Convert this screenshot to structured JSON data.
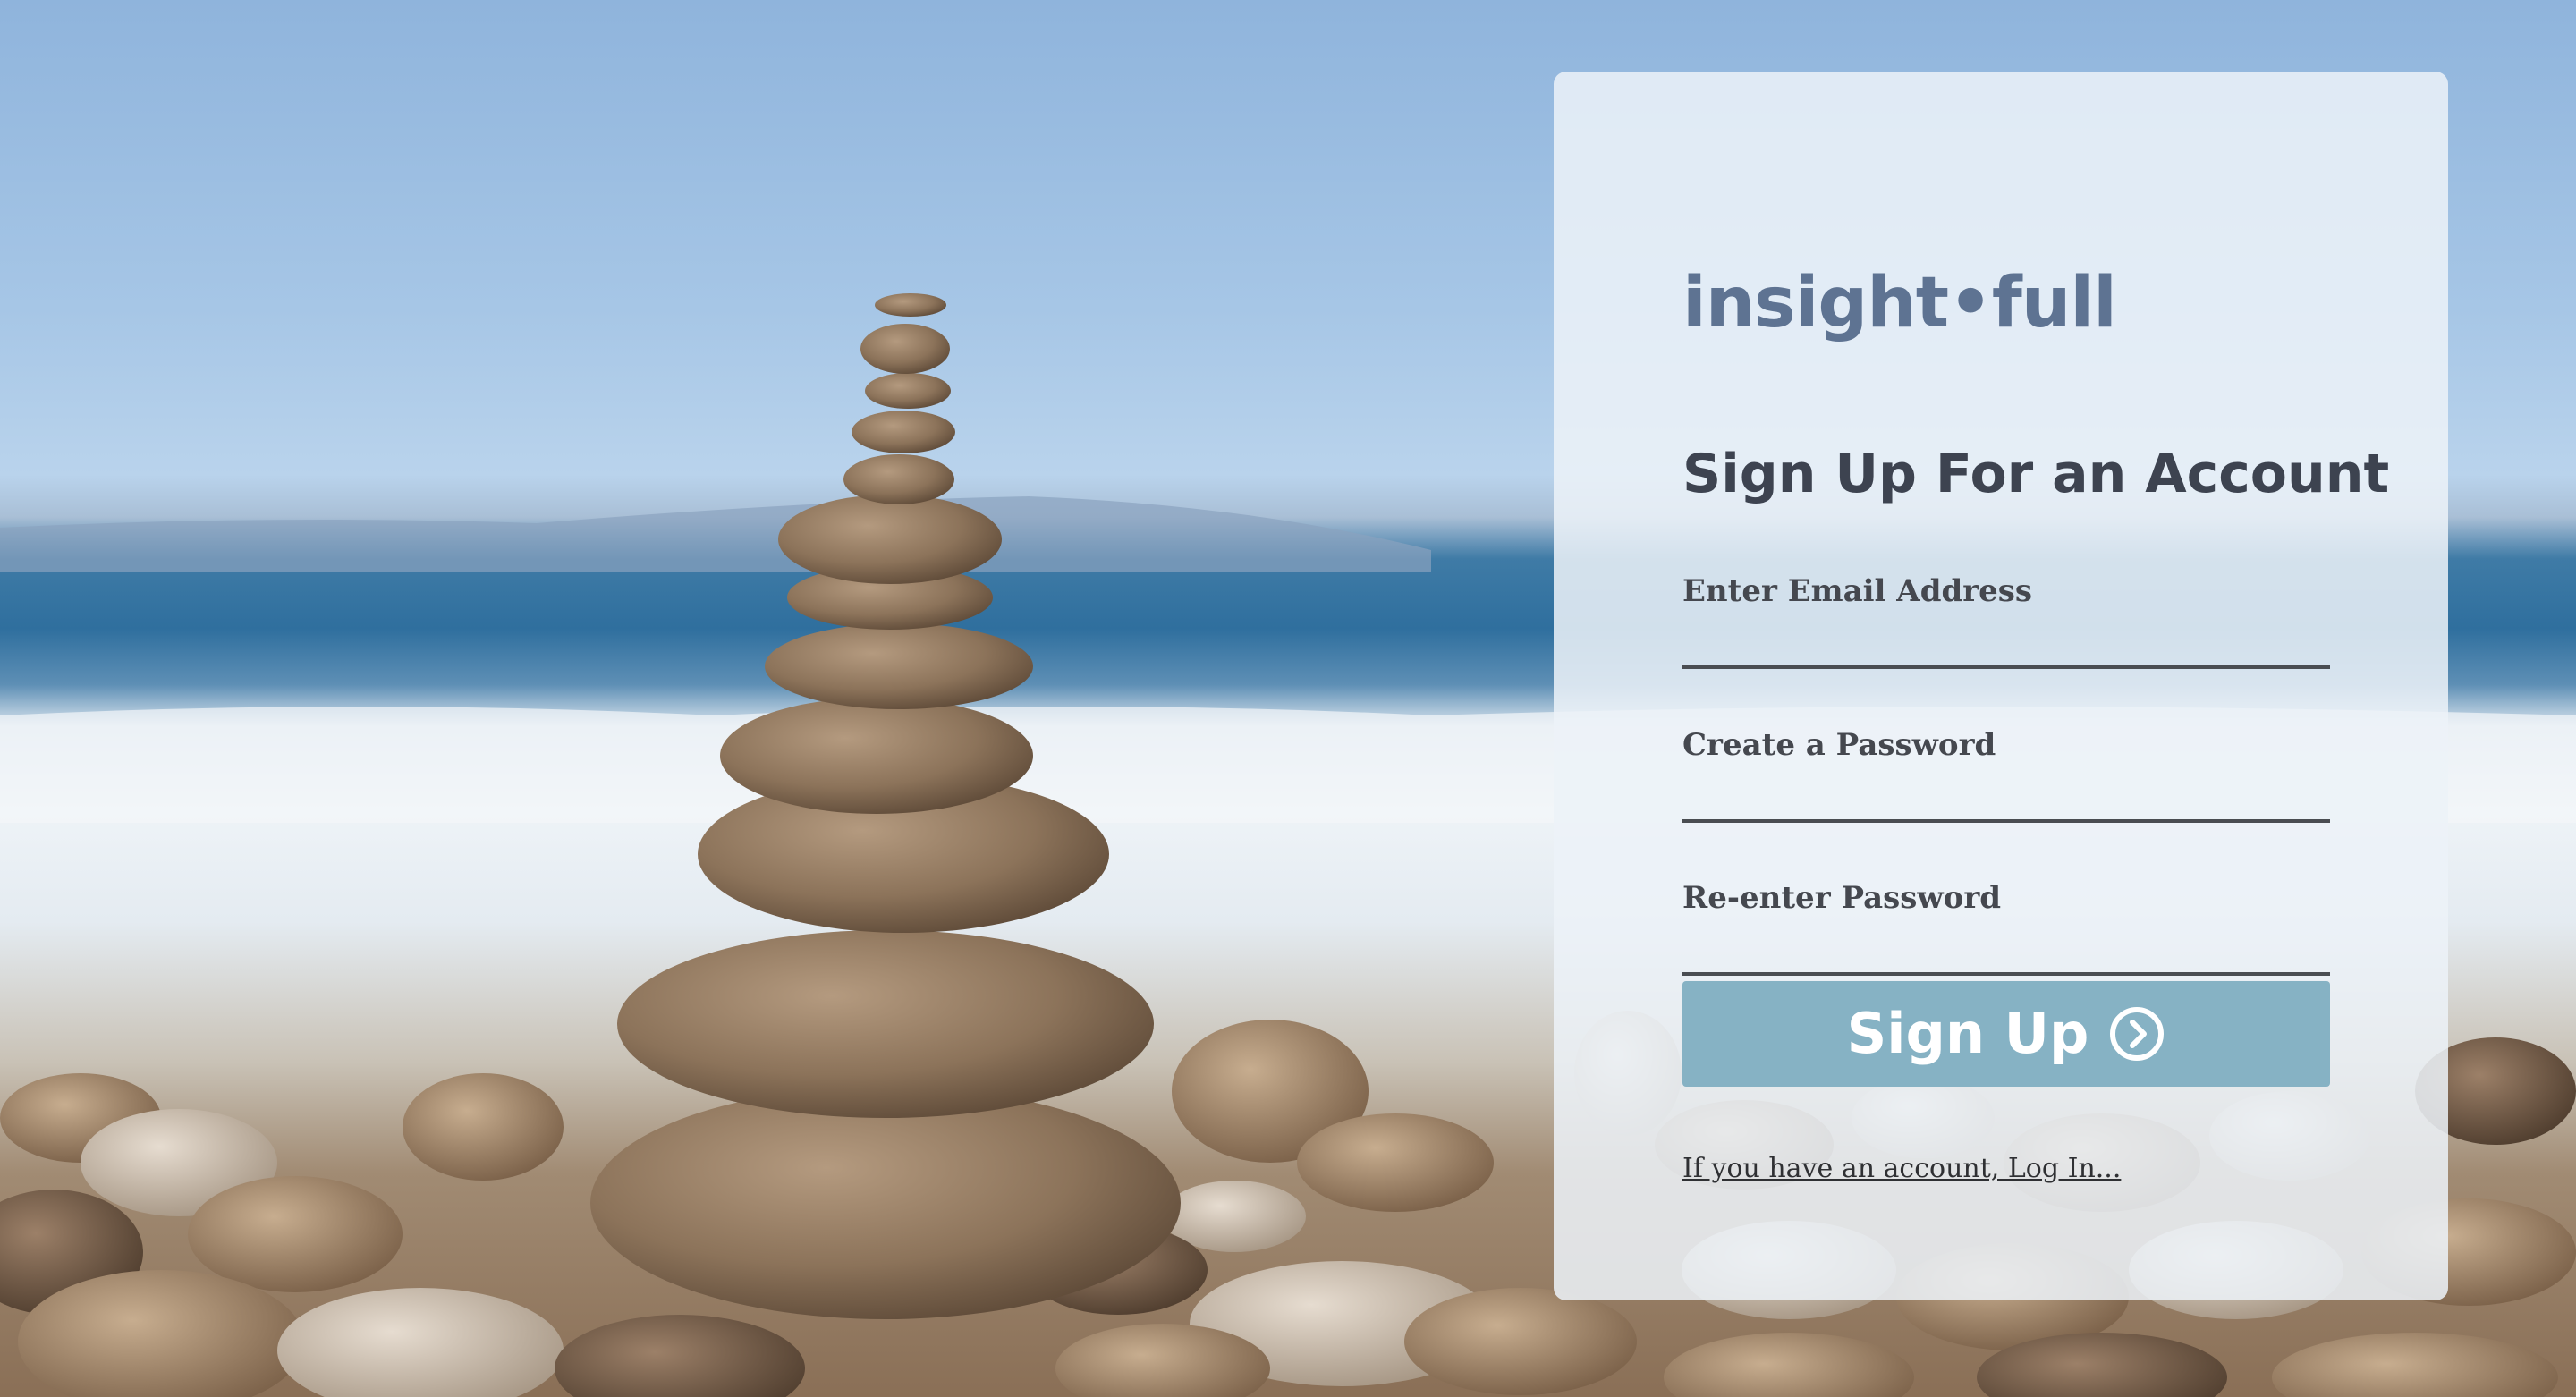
{
  "brand": {
    "logo_text": "insight•full"
  },
  "form": {
    "heading": "Sign Up For an Account",
    "fields": [
      {
        "label": "Enter Email Address",
        "value": ""
      },
      {
        "label": "Create a Password",
        "value": ""
      },
      {
        "label": "Re-enter Password",
        "value": ""
      }
    ],
    "submit_label": "Sign Up",
    "submit_icon": "chevron-right-circle-icon",
    "login_link_text": "If you have an account, Log In..."
  },
  "background": {
    "icon": "stacked-stones-beach-photo"
  },
  "colors": {
    "logo": "#5e7392",
    "heading": "#3d4350",
    "button": "#86b2c4",
    "button_text": "#ffffff"
  }
}
